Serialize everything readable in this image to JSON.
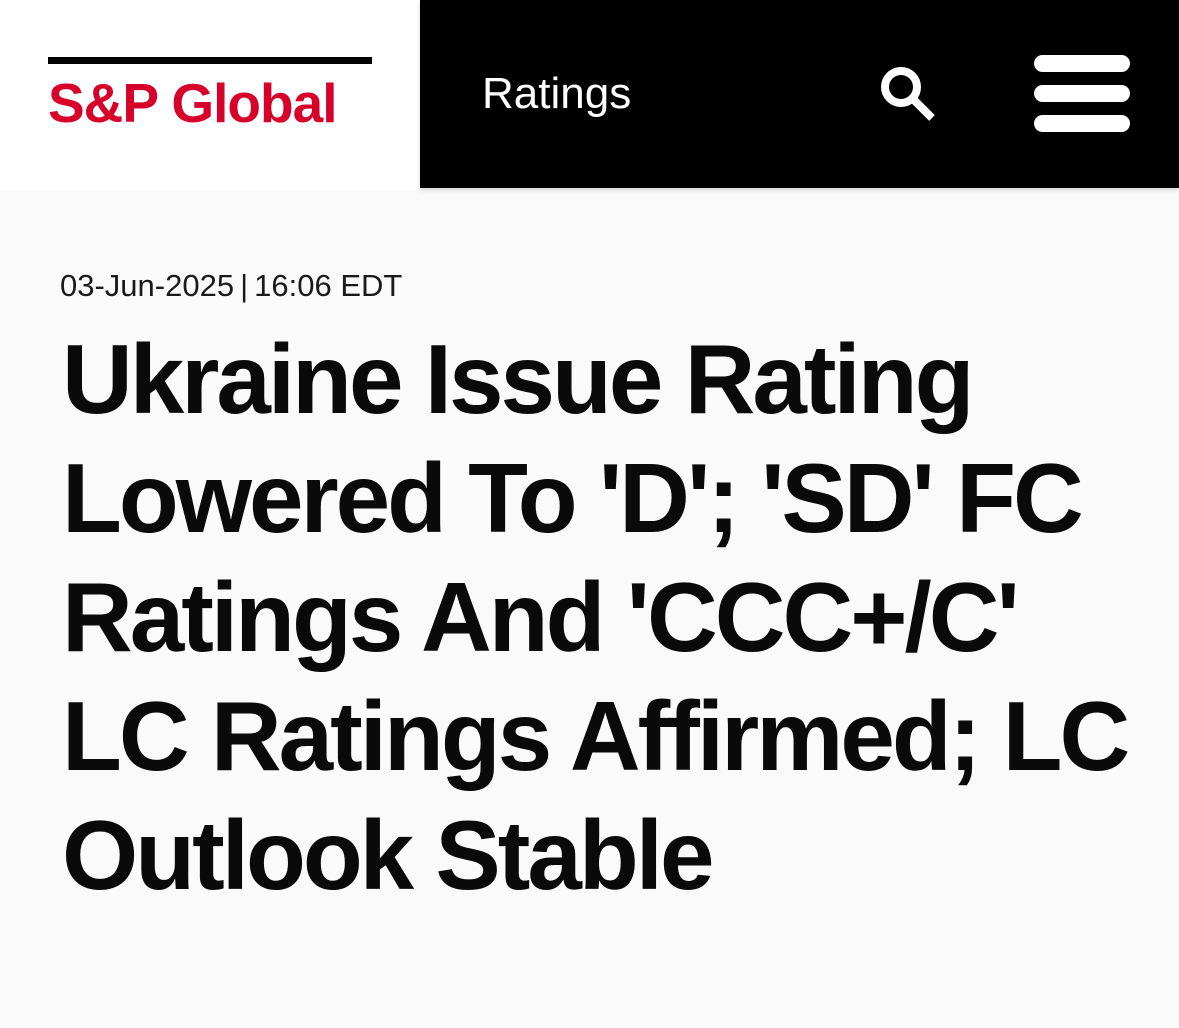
{
  "colors": {
    "brand_red": "#d6002a",
    "header_black": "#000000",
    "page_background": "#fafafa",
    "text": "#0a0a0a"
  },
  "header": {
    "logo_text": "S&P Global",
    "section_label": "Ratings",
    "search_icon": "search-icon",
    "menu_icon": "hamburger-menu-icon"
  },
  "article": {
    "date": "03-Jun-2025",
    "separator": "|",
    "time": "16:06 EDT",
    "headline": "Ukraine Issue Rating Lowered To 'D'; 'SD' FC Ratings And 'CCC+/C' LC Ratings Affirmed; LC Outlook Stable"
  }
}
